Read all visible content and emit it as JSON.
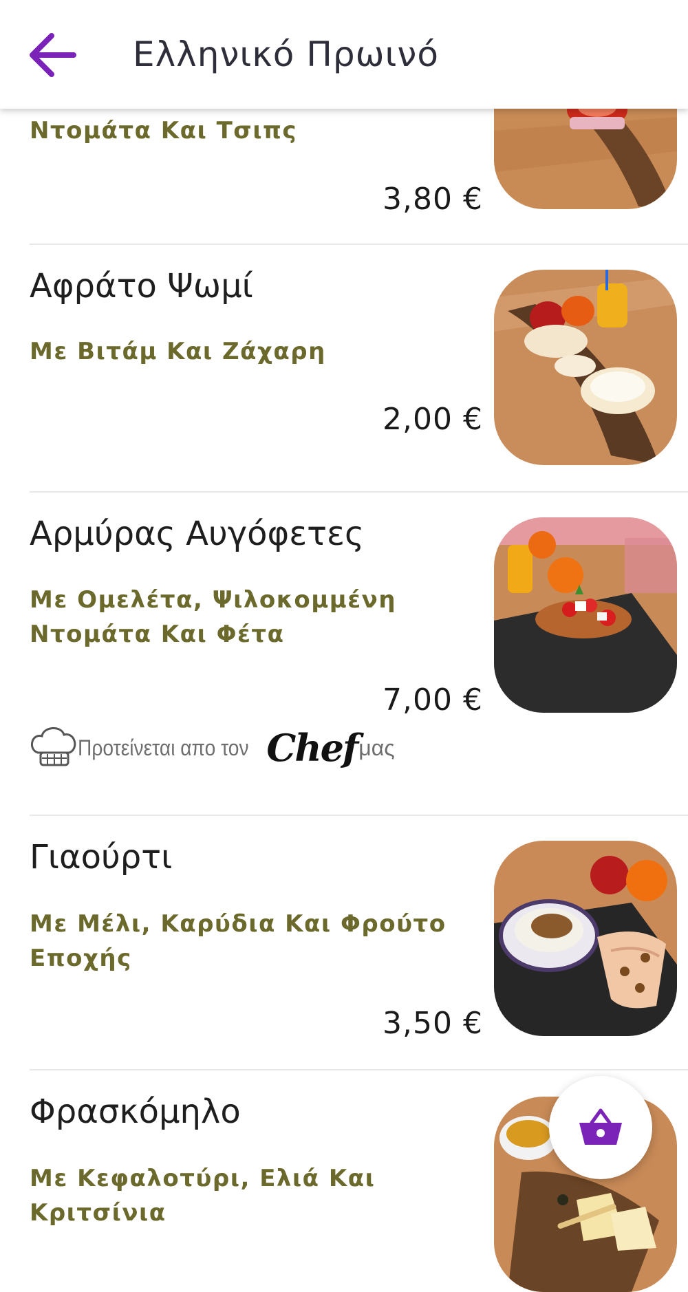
{
  "header": {
    "title": "Ελληνικό Πρωινό",
    "back_icon": "arrow-left-icon",
    "accent_color": "#7b22b8"
  },
  "items": [
    {
      "name": "",
      "description": "Ντομάτα Και Τσιπς",
      "price": "3,80 €",
      "chef_recommended": false
    },
    {
      "name": "Αφράτο Ψωμί",
      "description": "Με Βιτάμ Και Ζάχαρη",
      "price": "2,00 €",
      "chef_recommended": false
    },
    {
      "name": "Αρμύρας Αυγόφετες",
      "description": "Με Ομελέτα, Ψιλοκομμένη Ντομάτα Και Φέτα",
      "price": "7,00 €",
      "chef_recommended": true
    },
    {
      "name": "Γιαούρτι",
      "description": "Με Μέλι, Καρύδια Και Φρούτο Εποχής",
      "price": "3,50 €",
      "chef_recommended": false
    },
    {
      "name": "Φρασκόμηλο",
      "description": "Με Κεφαλοτύρι, Ελιά Και Κριτσίνια",
      "price": "",
      "chef_recommended": false
    }
  ],
  "chef_badge": {
    "text_before": "Προτείνεται απο τον",
    "script_word": "Chef",
    "text_after": "μας",
    "icon": "chef-hat-icon"
  },
  "cart_fab": {
    "icon": "basket-icon"
  },
  "colors": {
    "description": "#6b6a2c",
    "price": "#1a1a1a",
    "divider": "#e8e8e8"
  }
}
